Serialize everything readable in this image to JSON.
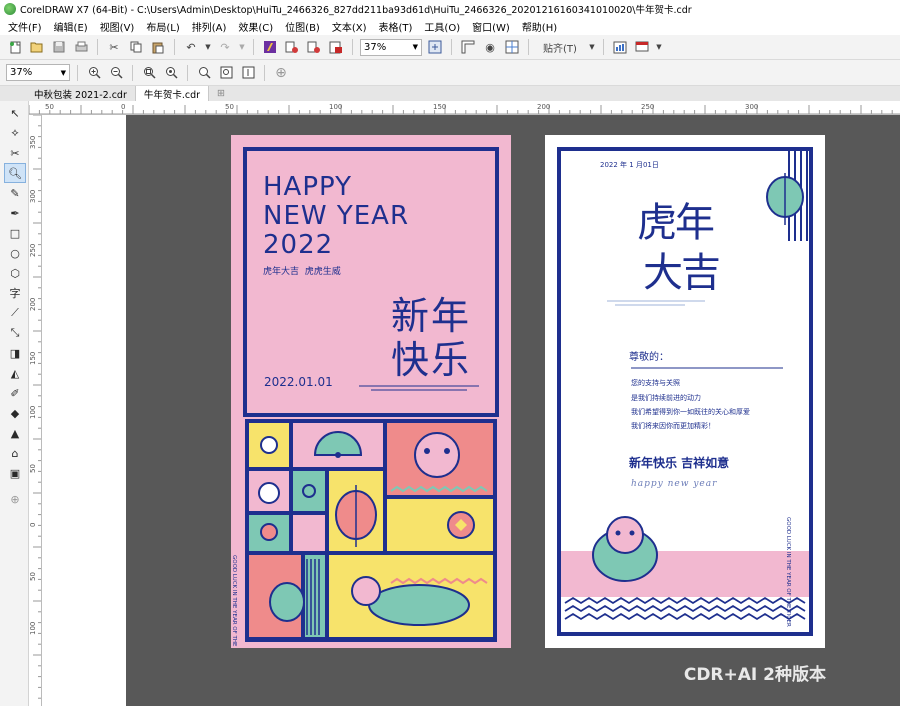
{
  "window": {
    "title": "CorelDRAW X7 (64-Bit) - C:\\Users\\Admin\\Desktop\\HuiTu_2466326_827dd211ba93d61d\\HuiTu_2466326_20201216160341010020\\牛年贺卡.cdr"
  },
  "menu": [
    "文件(F)",
    "编辑(E)",
    "视图(V)",
    "布局(L)",
    "排列(A)",
    "效果(C)",
    "位图(B)",
    "文本(X)",
    "表格(T)",
    "工具(O)",
    "窗口(W)",
    "帮助(H)"
  ],
  "toolbar": {
    "zoom_value": "37%",
    "snap_label": "贴齐(T)"
  },
  "propbar": {
    "zoom_value": "37%"
  },
  "tabs": [
    "中秋包装 2021-2.cdr",
    "牛年贺卡.cdr"
  ],
  "ruler": {
    "top_labels": [
      "50",
      "0",
      "50",
      "100",
      "150",
      "200",
      "250",
      "300"
    ],
    "left_labels": [
      "350",
      "300",
      "250",
      "200",
      "150",
      "100",
      "50",
      "0",
      "50",
      "100"
    ]
  },
  "card_left": {
    "headline": [
      "HAPPY",
      "NEW YEAR",
      "2022"
    ],
    "tagline": "虎年大吉  虎虎生威",
    "big_text_1": "新年",
    "big_text_2": "快乐",
    "date": "2022.01.01",
    "side_text": "GOOD LUCK IN THE YEAR OF THE TIGER"
  },
  "card_right": {
    "date_line": "2022 年 1 月01日",
    "big_text_1": "虎年",
    "big_text_2": "大吉",
    "greeting": "尊敬的：",
    "lines": [
      "您的支持与关照",
      "是我们持续前进的动力",
      "我们希望得到你一如既往的关心和厚爱",
      "我们将来因你而更加精彩！"
    ],
    "wish": "新年快乐 吉祥如意",
    "script_line": "happy new year",
    "side_text": "GOOD LUCK IN THE YEAR OF THE TIGER"
  },
  "caption": "CDR+AI 2种版本",
  "colors": {
    "navy": "#1e2f8e",
    "pink": "#f2b8d0",
    "yellow": "#f7e36b",
    "teal": "#7ec8b4",
    "coral": "#ef8b8b",
    "canvas": "#585858"
  }
}
